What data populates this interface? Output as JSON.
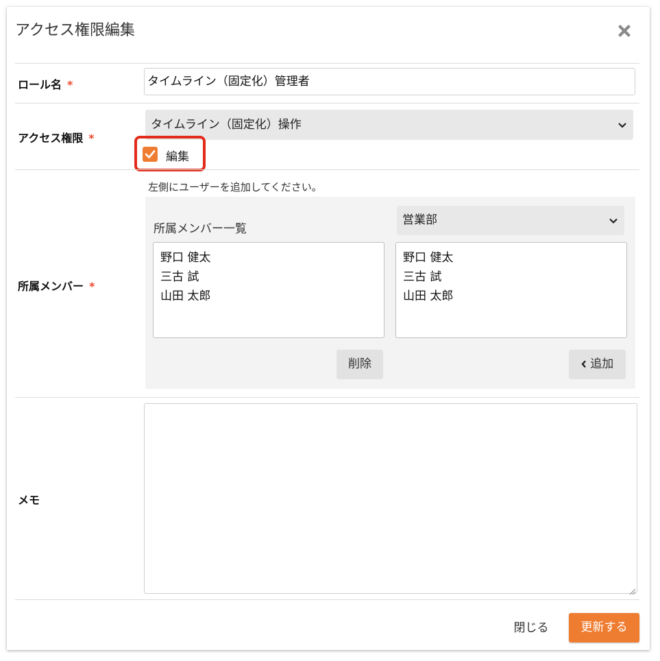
{
  "dialog": {
    "title": "アクセス権限編集",
    "close_icon": "close-icon"
  },
  "form": {
    "role_name": {
      "label": "ロール名",
      "required_mark": "*",
      "value": "タイムライン（固定化）管理者"
    },
    "access": {
      "label": "アクセス権限",
      "required_mark": "*",
      "selected": "タイムライン（固定化）操作",
      "checkbox_label": "編集",
      "checkbox_checked": true
    },
    "members": {
      "label": "所属メンバー",
      "required_mark": "*",
      "hint": "左側にユーザーを追加してください。",
      "list_title": "所属メンバー一覧",
      "department_selected": "営業部",
      "assigned": [
        "野口 健太",
        "三古 試",
        "山田 太郎"
      ],
      "available": [
        "野口 健太",
        "三古 試",
        "山田 太郎"
      ],
      "remove_label": "削除",
      "add_label": "追加"
    },
    "memo": {
      "label": "メモ",
      "value": ""
    }
  },
  "footer": {
    "close_label": "閉じる",
    "submit_label": "更新する"
  },
  "colors": {
    "accent": "#ef7d31",
    "required": "#e8492e",
    "highlight": "#e22b1a"
  }
}
